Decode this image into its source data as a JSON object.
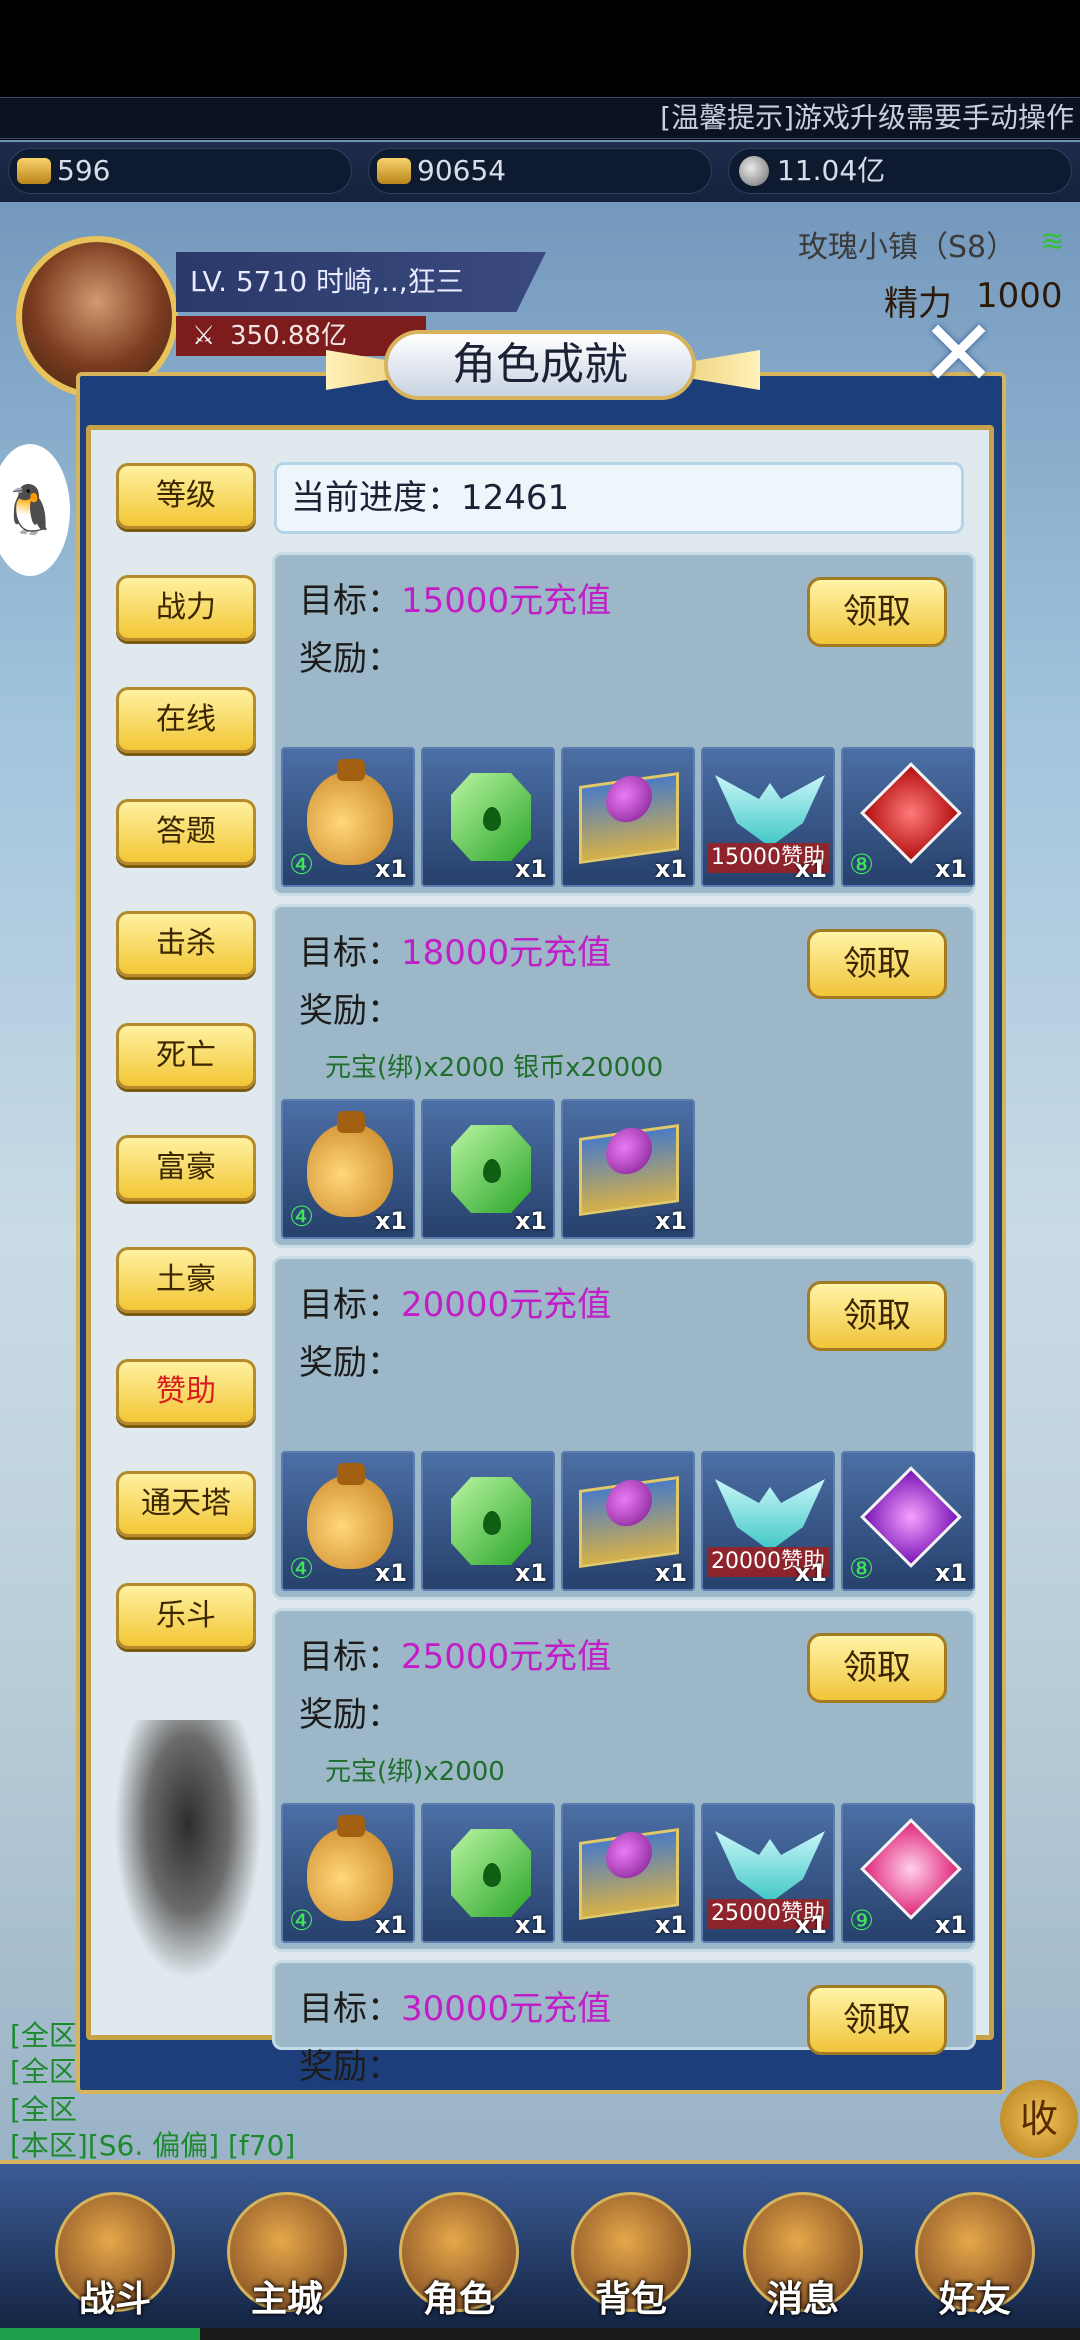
{
  "top_notice": "[温馨提示]游戏升级需要手动操作",
  "resources": {
    "ingot": "596",
    "bound_ingot": "90654",
    "silver": "11.04亿"
  },
  "server": "玫瑰小镇（S8）",
  "energy": {
    "label": "精力",
    "value": "1000"
  },
  "player": {
    "level_name": "LV. 5710 时崎,..,狂三",
    "power": "350.88亿"
  },
  "panel": {
    "title": "角色成就",
    "progress": "当前进度：12461",
    "tabs": [
      {
        "label": "等级"
      },
      {
        "label": "战力"
      },
      {
        "label": "在线"
      },
      {
        "label": "答题"
      },
      {
        "label": "击杀"
      },
      {
        "label": "死亡"
      },
      {
        "label": "富豪"
      },
      {
        "label": "土豪"
      },
      {
        "label": "赞助",
        "active": true
      },
      {
        "label": "通天塔"
      },
      {
        "label": "乐斗"
      }
    ],
    "cards": [
      {
        "goal_prefix": "目标：",
        "goal": "15000元充值",
        "reward_label": "奖励：",
        "claim": "领取",
        "subline": "",
        "items": [
          {
            "type": "bag",
            "lv": "④",
            "qty": "x1"
          },
          {
            "type": "emerald",
            "qty": "x1"
          },
          {
            "type": "box",
            "qty": "x1"
          },
          {
            "type": "wings",
            "band": "15000赞助",
            "qty": "x1"
          },
          {
            "type": "gem-red",
            "lv": "⑧",
            "qty": "x1"
          }
        ]
      },
      {
        "goal_prefix": "目标：",
        "goal": "18000元充值",
        "reward_label": "奖励：",
        "claim": "领取",
        "subline": "元宝(绑)x2000 银币x20000",
        "items": [
          {
            "type": "bag",
            "lv": "④",
            "qty": "x1"
          },
          {
            "type": "emerald",
            "qty": "x1"
          },
          {
            "type": "box",
            "qty": "x1"
          }
        ]
      },
      {
        "goal_prefix": "目标：",
        "goal": "20000元充值",
        "reward_label": "奖励：",
        "claim": "领取",
        "subline": "",
        "items": [
          {
            "type": "bag",
            "lv": "④",
            "qty": "x1"
          },
          {
            "type": "emerald",
            "qty": "x1"
          },
          {
            "type": "box",
            "qty": "x1"
          },
          {
            "type": "wings",
            "band": "20000赞助",
            "qty": "x1"
          },
          {
            "type": "gem-purple",
            "lv": "⑧",
            "qty": "x1"
          }
        ]
      },
      {
        "goal_prefix": "目标：",
        "goal": "25000元充值",
        "reward_label": "奖励：",
        "claim": "领取",
        "subline": "元宝(绑)x2000",
        "items": [
          {
            "type": "bag",
            "lv": "④",
            "qty": "x1"
          },
          {
            "type": "emerald",
            "qty": "x1"
          },
          {
            "type": "box",
            "qty": "x1"
          },
          {
            "type": "wings",
            "band": "25000赞助",
            "qty": "x1"
          },
          {
            "type": "gem-pink",
            "lv": "⑨",
            "qty": "x1"
          }
        ]
      },
      {
        "goal_prefix": "目标：",
        "goal": "30000元充值",
        "reward_label": "奖励：",
        "claim": "领取",
        "subline": "",
        "items": []
      }
    ]
  },
  "chat": [
    "[全区",
    "[全区",
    "[全区",
    "[本区][S6. 偏偏] [f70]"
  ],
  "collapse_label": "收",
  "nav": [
    "战斗",
    "主城",
    "角色",
    "背包",
    "消息",
    "好友"
  ]
}
